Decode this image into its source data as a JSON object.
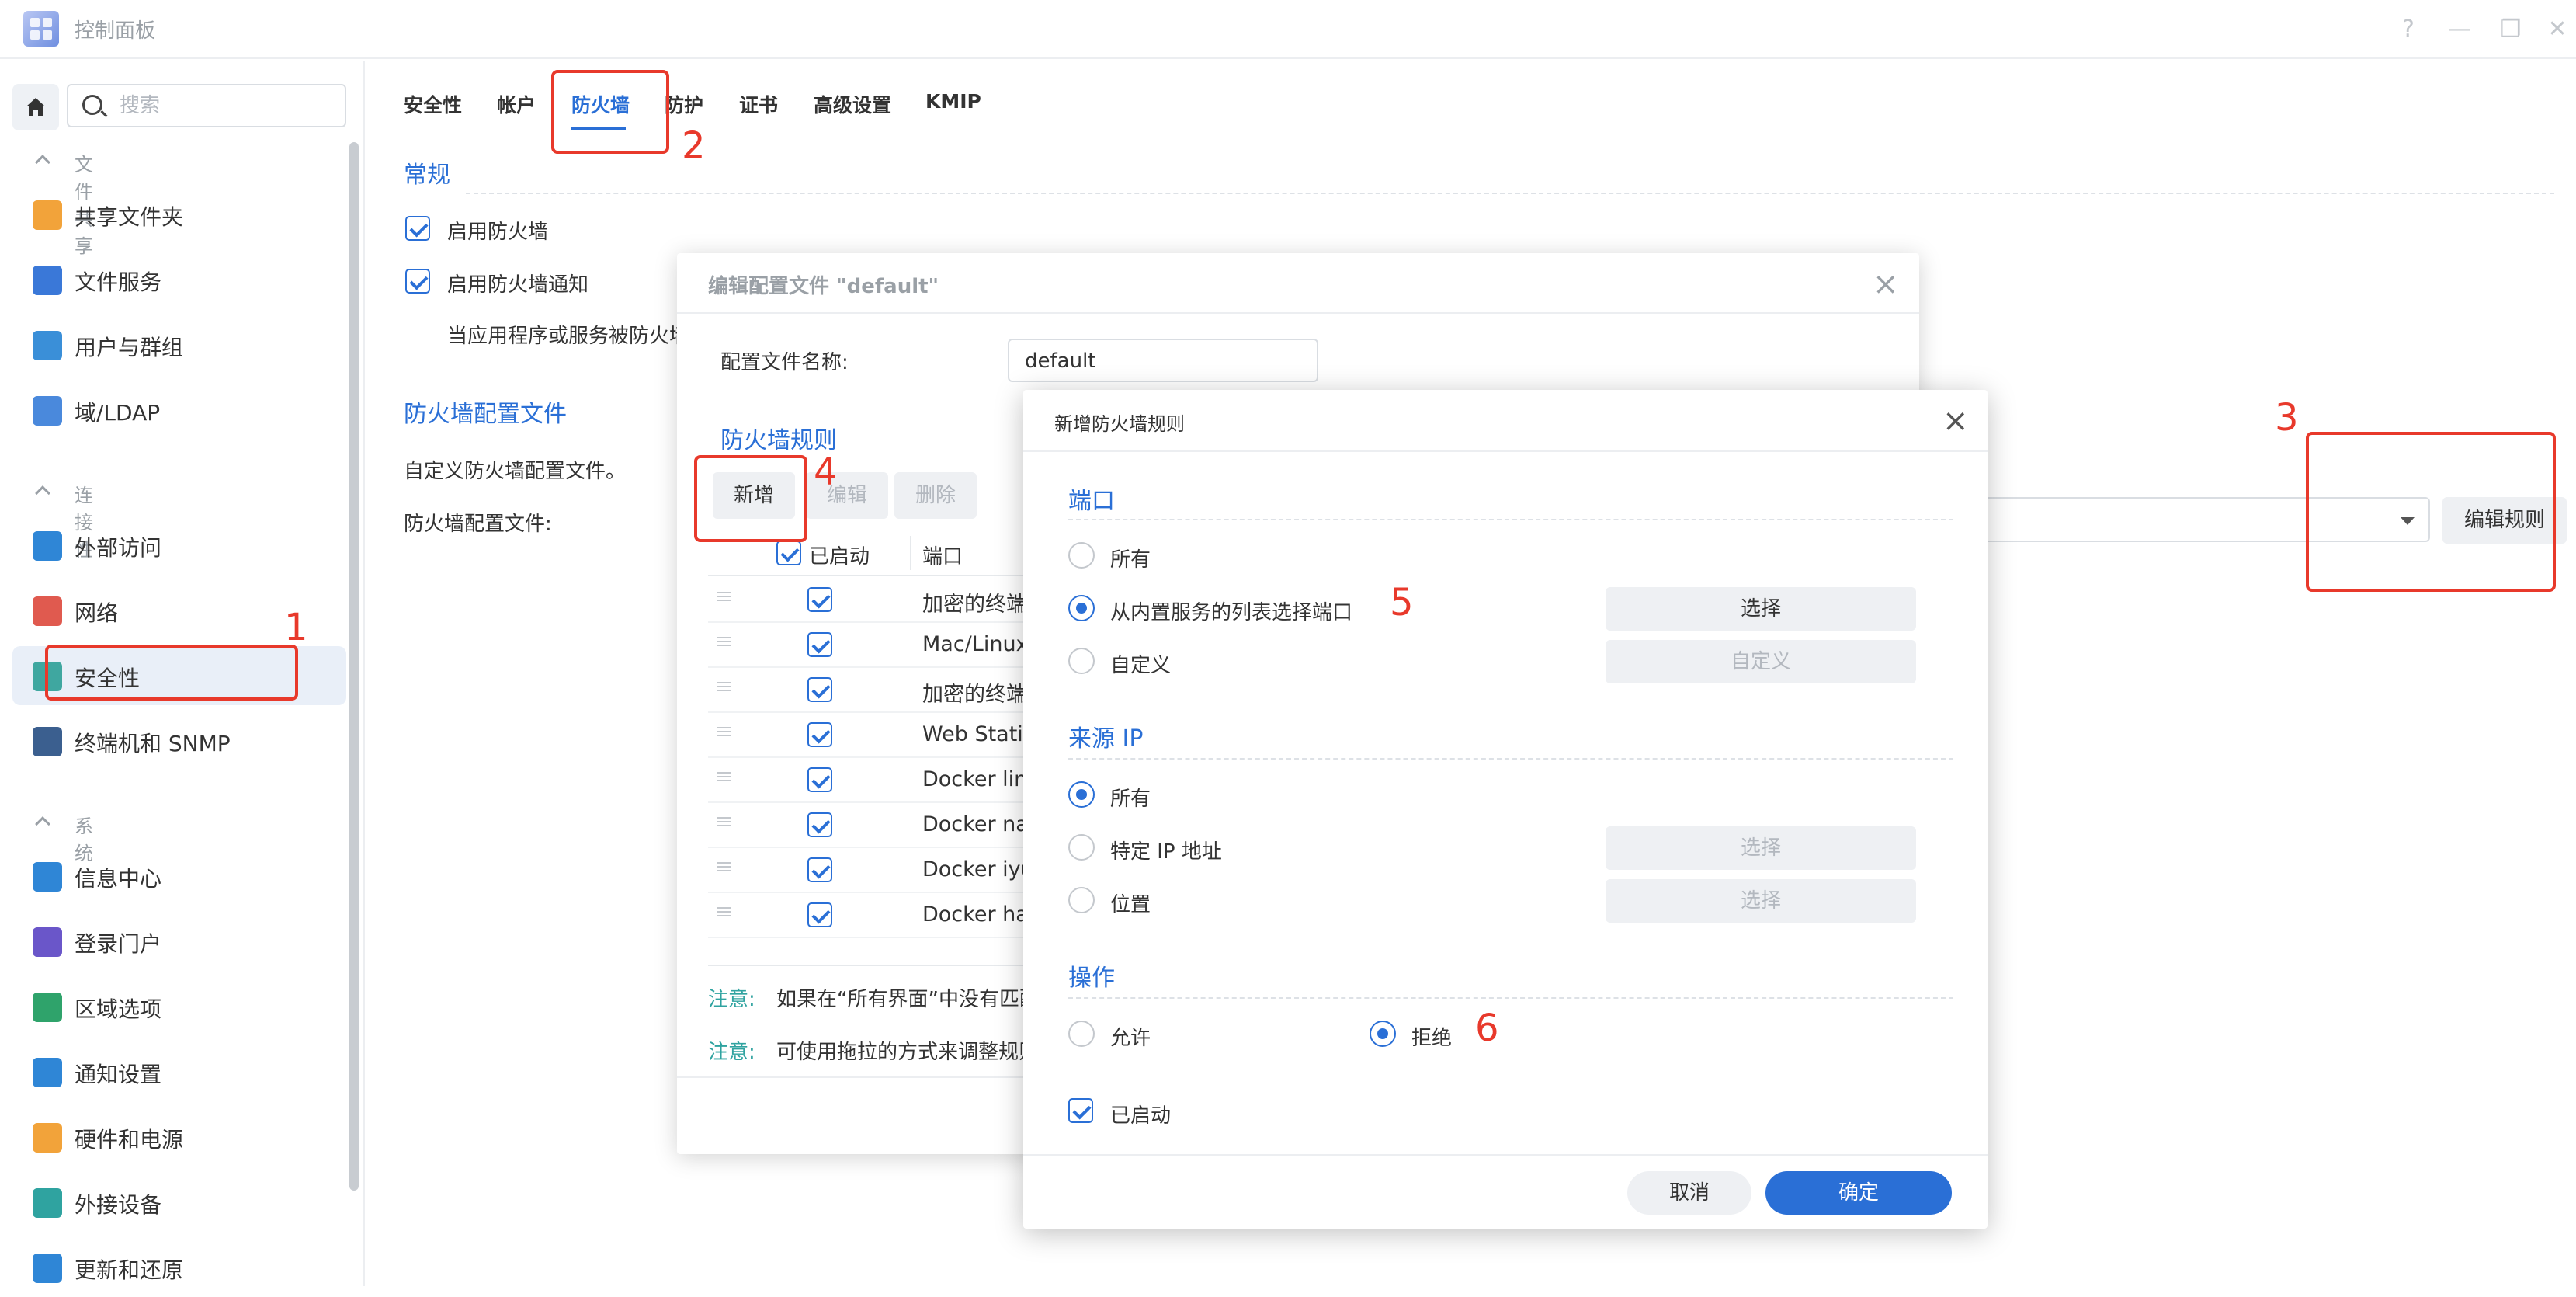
{
  "window": {
    "title": "控制面板",
    "help_icon": "?",
    "minimize_icon": "—",
    "restore_icon": "❐",
    "close_icon": "✕"
  },
  "sidebar": {
    "search_placeholder": "搜索",
    "groups": [
      {
        "label": "文件共享",
        "items": [
          {
            "label": "共享文件夹",
            "icon": "folder-icon",
            "color": "#f2a33a"
          },
          {
            "label": "文件服务",
            "icon": "file-services-icon",
            "color": "#3a78d8"
          },
          {
            "label": "用户与群组",
            "icon": "users-icon",
            "color": "#3a8fd8"
          },
          {
            "label": "域/LDAP",
            "icon": "domain-ldap-icon",
            "color": "#4a89dc"
          }
        ]
      },
      {
        "label": "连接性",
        "items": [
          {
            "label": "外部访问",
            "icon": "external-access-icon",
            "color": "#2f86d6"
          },
          {
            "label": "网络",
            "icon": "network-icon",
            "color": "#e05a4f"
          },
          {
            "label": "安全性",
            "icon": "shield-icon",
            "color": "#3fa7a0",
            "active": true
          },
          {
            "label": "终端机和 SNMP",
            "icon": "terminal-icon",
            "color": "#3b5f8f"
          }
        ]
      },
      {
        "label": "系统",
        "items": [
          {
            "label": "信息中心",
            "icon": "info-icon",
            "color": "#2f86d6"
          },
          {
            "label": "登录门户",
            "icon": "login-portal-icon",
            "color": "#6a56c9"
          },
          {
            "label": "区域选项",
            "icon": "regional-icon",
            "color": "#2fa36b"
          },
          {
            "label": "通知设置",
            "icon": "notification-icon",
            "color": "#2f86d6"
          },
          {
            "label": "硬件和电源",
            "icon": "hardware-icon",
            "color": "#f2a33a"
          },
          {
            "label": "外接设备",
            "icon": "external-device-icon",
            "color": "#2fa3a0"
          },
          {
            "label": "更新和还原",
            "icon": "update-icon",
            "color": "#2f86d6"
          }
        ]
      }
    ]
  },
  "tabs": [
    {
      "label": "安全性"
    },
    {
      "label": "帐户"
    },
    {
      "label": "防火墙",
      "active": true
    },
    {
      "label": "防护"
    },
    {
      "label": "证书"
    },
    {
      "label": "高级设置"
    },
    {
      "label": "KMIP"
    }
  ],
  "main": {
    "general_title": "常规",
    "enable_firewall": "启用防火墙",
    "enable_firewall_notify": "启用防火墙通知",
    "notify_desc": "当应用程序或服务被防火墙",
    "profile_title": "防火墙配置文件",
    "profile_desc": "自定义防火墙配置文件。",
    "profile_label": "防火墙配置文件:",
    "edit_rules": "编辑规则"
  },
  "dialog1": {
    "title": "编辑配置文件 \"default\"",
    "close_icon": "×",
    "name_label": "配置文件名称:",
    "name_value": "default",
    "rules_title": "防火墙规则",
    "btn_add": "新增",
    "btn_edit": "编辑",
    "btn_delete": "删除",
    "col_enabled": "已启动",
    "col_port": "端口",
    "rows": [
      {
        "port": "加密的终端"
      },
      {
        "port": "Mac/Linux"
      },
      {
        "port": "加密的终端"
      },
      {
        "port": "Web Statio"
      },
      {
        "port": "Docker lin"
      },
      {
        "port": "Docker na"
      },
      {
        "port": "Docker iyu"
      },
      {
        "port": "Docker ha"
      }
    ],
    "note_label": "注意:",
    "note1": "如果在“所有界面”中没有匹配",
    "note2": "可使用拖拉的方式来调整规则"
  },
  "dialog2": {
    "title": "新增防火墙规则",
    "close_icon": "×",
    "port_title": "端口",
    "port_all": "所有",
    "port_builtin": "从内置服务的列表选择端口",
    "port_custom": "自定义",
    "btn_select": "选择",
    "btn_custom": "自定义",
    "source_title": "来源 IP",
    "src_all": "所有",
    "src_specific": "特定 IP 地址",
    "src_location": "位置",
    "action_title": "操作",
    "allow": "允许",
    "deny": "拒绝",
    "enabled": "已启动",
    "cancel": "取消",
    "ok": "确定"
  },
  "annotations": [
    "1",
    "2",
    "3",
    "4",
    "5",
    "6"
  ],
  "colors": {
    "accent": "#2a6fd6",
    "annotation": "#e8392b"
  }
}
